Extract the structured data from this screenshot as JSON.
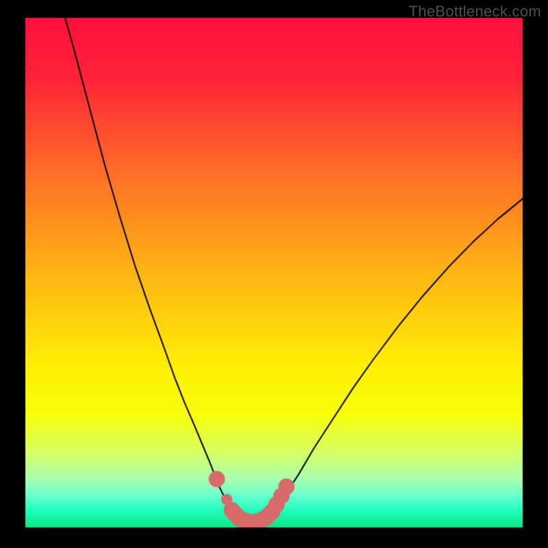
{
  "watermark": {
    "text": "TheBottleneck.com"
  },
  "chart_data": {
    "type": "line",
    "title": "",
    "xlabel": "",
    "ylabel": "",
    "xlim": [
      0,
      100
    ],
    "ylim": [
      0,
      100
    ],
    "background_gradient": {
      "stops": [
        {
          "t": 0.0,
          "color": "#ff0f3f"
        },
        {
          "t": 0.12,
          "color": "#ff2439"
        },
        {
          "t": 0.3,
          "color": "#ff6d27"
        },
        {
          "t": 0.5,
          "color": "#ffb514"
        },
        {
          "t": 0.68,
          "color": "#ffee05"
        },
        {
          "t": 0.78,
          "color": "#f7ff0c"
        },
        {
          "t": 0.85,
          "color": "#d9ff62"
        },
        {
          "t": 0.905,
          "color": "#a8ffb0"
        },
        {
          "t": 0.935,
          "color": "#6fffcc"
        },
        {
          "t": 0.965,
          "color": "#23ffbf"
        },
        {
          "t": 1.0,
          "color": "#06e884"
        }
      ]
    },
    "curve_left": {
      "stroke": "#000000",
      "stroke_width": 2,
      "points": [
        {
          "x": 8.0,
          "y": 100.0
        },
        {
          "x": 10.0,
          "y": 93.0
        },
        {
          "x": 13.0,
          "y": 82.0
        },
        {
          "x": 16.0,
          "y": 71.0
        },
        {
          "x": 19.0,
          "y": 61.0
        },
        {
          "x": 22.0,
          "y": 51.5
        },
        {
          "x": 25.0,
          "y": 43.0
        },
        {
          "x": 28.0,
          "y": 35.0
        },
        {
          "x": 30.0,
          "y": 29.5
        },
        {
          "x": 32.0,
          "y": 24.5
        },
        {
          "x": 34.0,
          "y": 20.0
        },
        {
          "x": 35.5,
          "y": 16.5
        },
        {
          "x": 37.0,
          "y": 13.0
        },
        {
          "x": 38.0,
          "y": 10.5
        },
        {
          "x": 39.0,
          "y": 8.0
        },
        {
          "x": 40.0,
          "y": 6.0
        },
        {
          "x": 41.0,
          "y": 4.3
        },
        {
          "x": 42.0,
          "y": 3.0
        },
        {
          "x": 43.0,
          "y": 2.1
        },
        {
          "x": 44.0,
          "y": 1.4
        },
        {
          "x": 45.0,
          "y": 1.0
        },
        {
          "x": 46.0,
          "y": 1.0
        }
      ]
    },
    "curve_right": {
      "stroke": "#000000",
      "stroke_width": 2,
      "points": [
        {
          "x": 46.0,
          "y": 1.0
        },
        {
          "x": 47.5,
          "y": 1.3
        },
        {
          "x": 49.0,
          "y": 2.2
        },
        {
          "x": 50.0,
          "y": 3.3
        },
        {
          "x": 51.0,
          "y": 4.7
        },
        {
          "x": 53.0,
          "y": 7.5
        },
        {
          "x": 55.0,
          "y": 10.5
        },
        {
          "x": 58.0,
          "y": 15.5
        },
        {
          "x": 62.0,
          "y": 21.5
        },
        {
          "x": 66.0,
          "y": 27.5
        },
        {
          "x": 70.0,
          "y": 33.0
        },
        {
          "x": 75.0,
          "y": 39.5
        },
        {
          "x": 80.0,
          "y": 45.5
        },
        {
          "x": 85.0,
          "y": 51.0
        },
        {
          "x": 90.0,
          "y": 56.0
        },
        {
          "x": 95.0,
          "y": 60.5
        },
        {
          "x": 100.0,
          "y": 64.5
        }
      ]
    },
    "markers": {
      "fill": "#d76a6a",
      "stroke": "#d76a6a",
      "radius_small": 1.1,
      "radius_large": 1.6,
      "bridge_stroke_width": 3.2,
      "points": [
        {
          "x": 38.5,
          "y": 9.5,
          "r": "large"
        },
        {
          "x": 40.5,
          "y": 5.5,
          "r": "small"
        },
        {
          "x": 42.5,
          "y": 2.2,
          "r": "small"
        },
        {
          "x": 44.0,
          "y": 1.2,
          "r": "small"
        },
        {
          "x": 46.0,
          "y": 1.0,
          "r": "small"
        },
        {
          "x": 48.0,
          "y": 1.5,
          "r": "small"
        },
        {
          "x": 49.5,
          "y": 3.0,
          "r": "small"
        },
        {
          "x": 50.5,
          "y": 4.5,
          "r": "large"
        },
        {
          "x": 51.5,
          "y": 6.2,
          "r": "large"
        },
        {
          "x": 52.5,
          "y": 8.0,
          "r": "large"
        }
      ],
      "bridge": [
        {
          "x": 41.5,
          "y": 3.4
        },
        {
          "x": 43.0,
          "y": 1.8
        },
        {
          "x": 45.0,
          "y": 1.0
        },
        {
          "x": 47.0,
          "y": 1.2
        },
        {
          "x": 48.5,
          "y": 2.0
        },
        {
          "x": 49.7,
          "y": 3.2
        }
      ]
    }
  }
}
